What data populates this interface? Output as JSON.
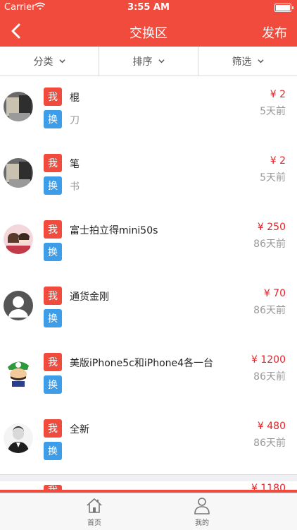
{
  "status_bar": {
    "carrier": "Carrier",
    "time": "3:55 AM"
  },
  "nav": {
    "title": "交换区",
    "publish": "发布"
  },
  "filters": [
    {
      "label": "分类"
    },
    {
      "label": "排序"
    },
    {
      "label": "筛选"
    }
  ],
  "tags": {
    "me": "我",
    "swap": "换"
  },
  "items": [
    {
      "have": "棍",
      "want": "刀",
      "price": "¥ 2",
      "time": "5天前",
      "avatar": "photo-avatar-icon"
    },
    {
      "have": "笔",
      "want": "书",
      "price": "¥ 2",
      "time": "5天前",
      "avatar": "photo-avatar-icon"
    },
    {
      "have": "富士拍立得mini50s",
      "want": "",
      "price": "¥ 250",
      "time": "86天前",
      "avatar": "girl-avatar-icon"
    },
    {
      "have": "通货金刚",
      "want": "",
      "price": "¥ 70",
      "time": "86天前",
      "avatar": "default-user-avatar-icon"
    },
    {
      "have": "美版iPhone5c和iPhone4各一台",
      "want": "",
      "price": "¥ 1200",
      "time": "86天前",
      "avatar": "luigi-avatar-icon"
    },
    {
      "have": "全新",
      "want": "",
      "price": "¥ 480",
      "time": "86天前",
      "avatar": "suit-man-avatar-icon"
    }
  ],
  "peek_item": {
    "price": "¥ 1180"
  },
  "tabs": [
    {
      "label": "首页",
      "icon": "home-icon"
    },
    {
      "label": "我的",
      "icon": "person-icon"
    }
  ],
  "colors": {
    "primary": "#f14b3e",
    "swap_tag": "#3d9de9",
    "price": "#e0252a"
  }
}
